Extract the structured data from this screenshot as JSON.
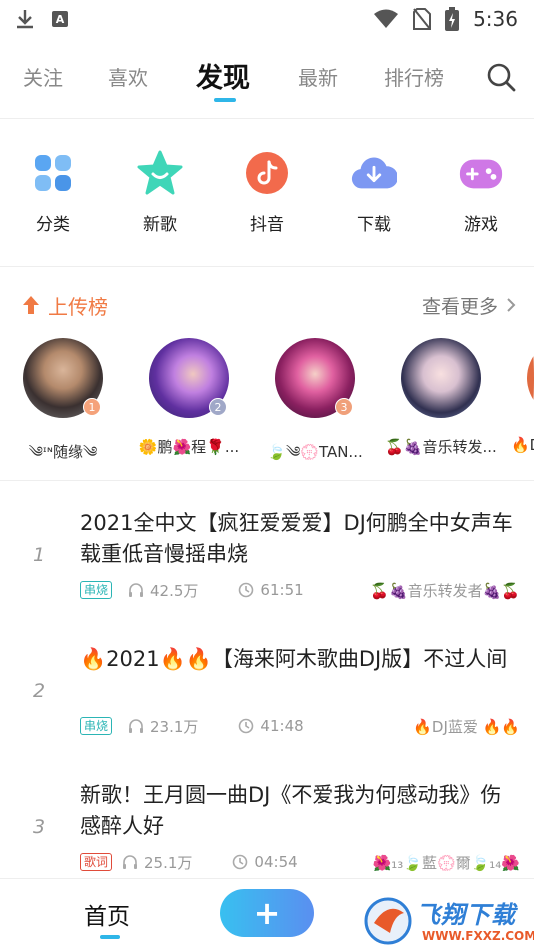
{
  "status_bar": {
    "time": "5:36",
    "icons": [
      "download-icon",
      "a-icon",
      "wifi-icon",
      "no-sim-icon",
      "battery-charging-icon"
    ],
    "a_letter": "A"
  },
  "top_tabs": [
    {
      "label": "关注"
    },
    {
      "label": "喜欢"
    },
    {
      "label": "发现",
      "active": true
    },
    {
      "label": "最新"
    },
    {
      "label": "排行榜"
    }
  ],
  "quick_actions": [
    {
      "label": "分类",
      "icon": "category-grid-icon",
      "color": "#4aa3f0"
    },
    {
      "label": "新歌",
      "icon": "star-smile-icon",
      "color": "#3fd6b8"
    },
    {
      "label": "抖音",
      "icon": "tiktok-icon",
      "color": "#f06a4a"
    },
    {
      "label": "下载",
      "icon": "cloud-download-icon",
      "color": "#6a8cf0"
    },
    {
      "label": "游戏",
      "icon": "gamepad-icon",
      "color": "#c66ae0"
    }
  ],
  "upload_rank": {
    "title": "上传榜",
    "more": "查看更多",
    "accent": "#f07a44",
    "users": [
      {
        "name": "༄ᶦᶰ随缘༄",
        "rank": "1",
        "badge_color": "#f5a27a"
      },
      {
        "name": "🌼鹏🌺程🌹...",
        "rank": "2",
        "badge_color": "#a0a8c8"
      },
      {
        "name": "🍃༄💮TAN...",
        "rank": "3",
        "badge_color": "#f0a07a"
      },
      {
        "name": "🍒🍇音乐转发...",
        "rank": "",
        "badge_color": ""
      },
      {
        "name": "🔥D",
        "rank": "",
        "badge_color": ""
      }
    ]
  },
  "songs": [
    {
      "index": "1",
      "title": "2021全中文【疯狂爱爱爱】DJ何鹏全中女声车载重低音慢摇串烧",
      "tag": "串烧",
      "plays": "42.5万",
      "duration": "61:51",
      "uploader": "🍒🍇音乐转发者🍇🍒"
    },
    {
      "index": "2",
      "title": "🔥2021🔥🔥【海来阿木歌曲DJ版】不过人间",
      "tag": "串烧",
      "plays": "23.1万",
      "duration": "41:48",
      "uploader": "🔥DJ蓝爱 🔥🔥"
    },
    {
      "index": "3",
      "title": "新歌！王月圆一曲DJ《不爱我为何感动我》伤感醉人好",
      "tag": "歌词",
      "plays": "25.1万",
      "duration": "04:54",
      "uploader": "🌺₁₃🍃藍💮爾🍃₁₄🌺"
    }
  ],
  "bottom_nav": {
    "home": "首页",
    "plus": "+",
    "watermark": "飞翔下载",
    "watermark_url": "WWW.FXXZ.COM"
  }
}
